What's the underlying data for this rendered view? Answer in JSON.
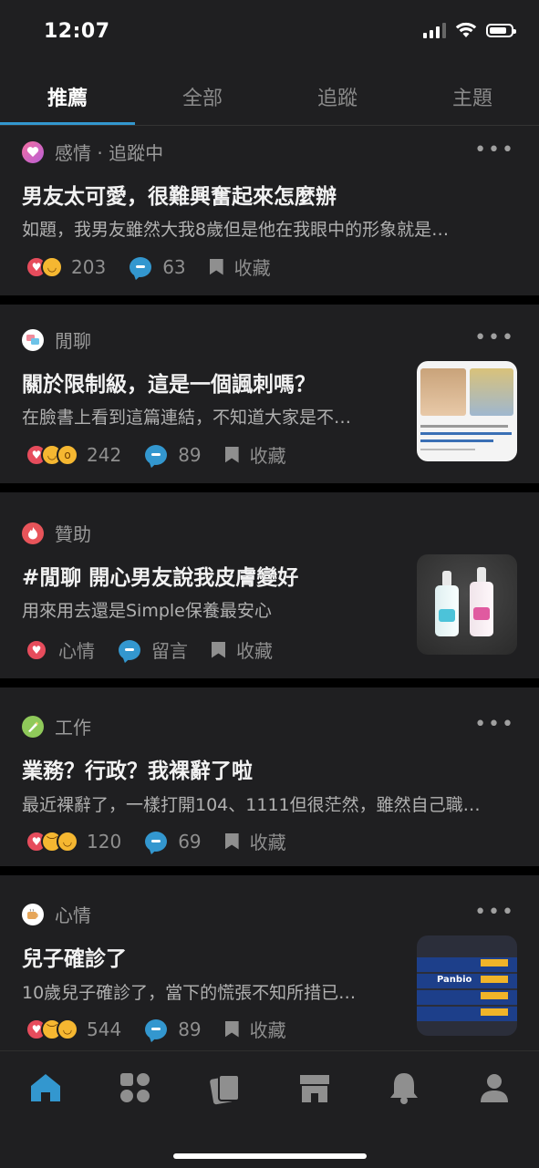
{
  "status_bar": {
    "time": "12:07"
  },
  "tabs": [
    {
      "label": "推薦",
      "active": true
    },
    {
      "label": "全部",
      "active": false
    },
    {
      "label": "追蹤",
      "active": false
    },
    {
      "label": "主題",
      "active": false
    }
  ],
  "posts": [
    {
      "forum": "感情 · 追蹤中",
      "forum_icon": "heart-forum-icon",
      "title": "男友太可愛，很難興奮起來怎麼辦",
      "excerpt": "如題，我男友雖然大我8歲但是他在我眼中的形象就是…",
      "reactions": [
        "heart",
        "laugh"
      ],
      "likes": "203",
      "comments": "63",
      "bookmark_label": "收藏"
    },
    {
      "forum": "閒聊",
      "forum_icon": "chat-forum-icon",
      "title": "關於限制級，這是一個諷刺嗎？",
      "excerpt": "在臉書上看到這篇連結，不知道大家是不…",
      "reactions": [
        "heart",
        "laugh",
        "wow"
      ],
      "likes": "242",
      "comments": "89",
      "bookmark_label": "收藏",
      "thumbnail": "news-screenshot-thumbnail"
    },
    {
      "forum": "贊助",
      "forum_icon": "sponsor-flame-icon",
      "title": "#閒聊 開心男友說我皮膚變好",
      "excerpt": "用來用去還是Simple保養最安心",
      "mood_label": "心情",
      "comment_label": "留言",
      "bookmark_label": "收藏",
      "thumbnail": "serum-bottles-thumbnail"
    },
    {
      "forum": "工作",
      "forum_icon": "work-forum-icon",
      "title": "業務？行政？我裸辭了啦",
      "excerpt": "最近裸辭了，一樣打開104、1111但很茫然，雖然自己職…",
      "reactions": [
        "heart",
        "sad",
        "laugh"
      ],
      "likes": "120",
      "comments": "69",
      "bookmark_label": "收藏"
    },
    {
      "forum": "心情",
      "forum_icon": "mood-forum-icon",
      "title": "兒子確診了",
      "excerpt": "10歲兒子確診了，當下的慌張不知所措已…",
      "reactions": [
        "heart",
        "sad",
        "laugh"
      ],
      "likes": "544",
      "comments": "89",
      "bookmark_label": "收藏",
      "thumbnail": "panbio-test-kits-thumbnail",
      "thumbnail_text": "Panbio"
    }
  ],
  "bottom_nav": [
    {
      "icon": "home-icon",
      "active": true
    },
    {
      "icon": "forums-grid-icon",
      "active": false
    },
    {
      "icon": "cards-icon",
      "active": false
    },
    {
      "icon": "store-icon",
      "active": false
    },
    {
      "icon": "bell-icon",
      "active": false
    },
    {
      "icon": "profile-icon",
      "active": false
    }
  ],
  "colors": {
    "accent": "#3397cf",
    "background": "#1f1f21",
    "heart": "#e64c5c",
    "emoji_yellow": "#f5b731"
  }
}
